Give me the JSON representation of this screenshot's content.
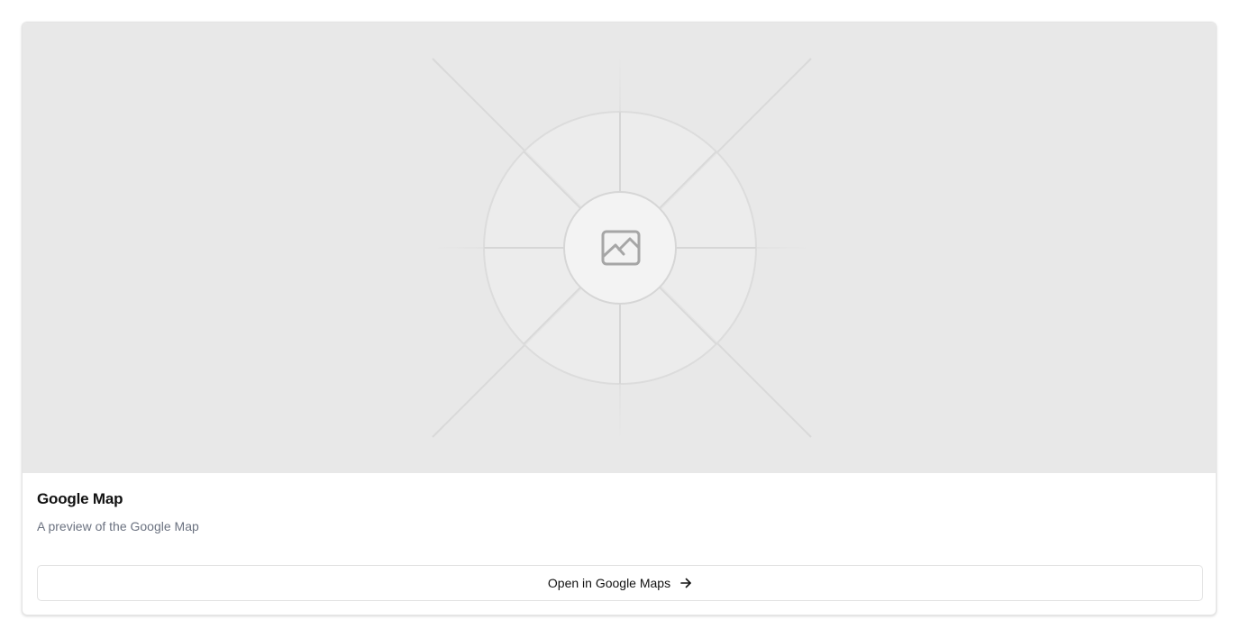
{
  "card": {
    "title": "Google Map",
    "description": "A preview of the Google Map",
    "button_label": "Open in Google Maps",
    "button_icon": "arrow-right-icon"
  },
  "preview": {
    "placeholder_icon": "image-placeholder-icon",
    "background_color": "#e8e8e8"
  }
}
